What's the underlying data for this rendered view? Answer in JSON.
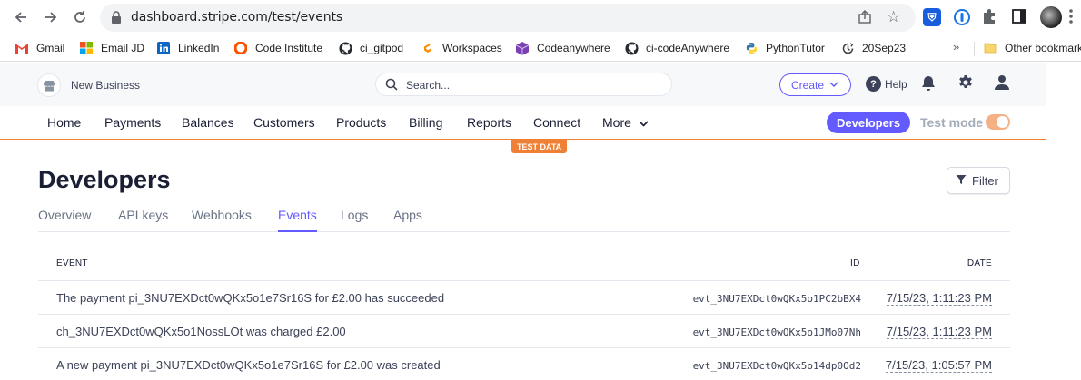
{
  "browser": {
    "url": "dashboard.stripe.com/test/events",
    "bookmarks": [
      {
        "label": "Gmail",
        "icon": "gmail-icon"
      },
      {
        "label": "Email JD",
        "icon": "microsoft-icon"
      },
      {
        "label": "LinkedIn",
        "icon": "linkedin-icon"
      },
      {
        "label": "Code Institute",
        "icon": "code-institute-icon"
      },
      {
        "label": "ci_gitpod",
        "icon": "github-icon"
      },
      {
        "label": "Workspaces",
        "icon": "gitpod-icon"
      },
      {
        "label": "Codeanywhere",
        "icon": "codeanywhere-icon"
      },
      {
        "label": "ci-codeAnywhere",
        "icon": "github-icon"
      },
      {
        "label": "PythonTutor",
        "icon": "python-icon"
      },
      {
        "label": "20Sep23",
        "icon": "clock-icon"
      }
    ],
    "more": "»",
    "other_bookmarks": "Other bookmarks"
  },
  "topbar": {
    "business_name": "New Business",
    "search_placeholder": "Search...",
    "create_label": "Create",
    "help_label": "Help"
  },
  "nav": {
    "items": [
      "Home",
      "Payments",
      "Balances",
      "Customers",
      "Products",
      "Billing",
      "Reports",
      "Connect"
    ],
    "more_label": "More",
    "developers_label": "Developers",
    "test_mode_label": "Test mode",
    "test_mode_on": true,
    "test_data_badge": "TEST DATA"
  },
  "page": {
    "title": "Developers",
    "filter_label": "Filter",
    "tabs": [
      "Overview",
      "API keys",
      "Webhooks",
      "Events",
      "Logs",
      "Apps"
    ],
    "active_tab": "Events"
  },
  "table": {
    "headers": {
      "event": "EVENT",
      "id": "ID",
      "date": "DATE"
    },
    "rows": [
      {
        "event": "The payment pi_3NU7EXDct0wQKx5o1e7Sr16S for £2.00 has succeeded",
        "id": "evt_3NU7EXDct0wQKx5o1PC2bBX4",
        "date": "7/15/23, 1:11:23 PM"
      },
      {
        "event": "ch_3NU7EXDct0wQKx5o1NossLOt was charged £2.00",
        "id": "evt_3NU7EXDct0wQKx5o1JMo07Nh",
        "date": "7/15/23, 1:11:23 PM"
      },
      {
        "event": "A new payment pi_3NU7EXDct0wQKx5o1e7Sr16S for £2.00 was created",
        "id": "evt_3NU7EXDct0wQKx5o14dp0Od2",
        "date": "7/15/23, 1:05:57 PM"
      }
    ]
  },
  "colors": {
    "accent": "#635bff",
    "test_mode": "#f08035"
  }
}
